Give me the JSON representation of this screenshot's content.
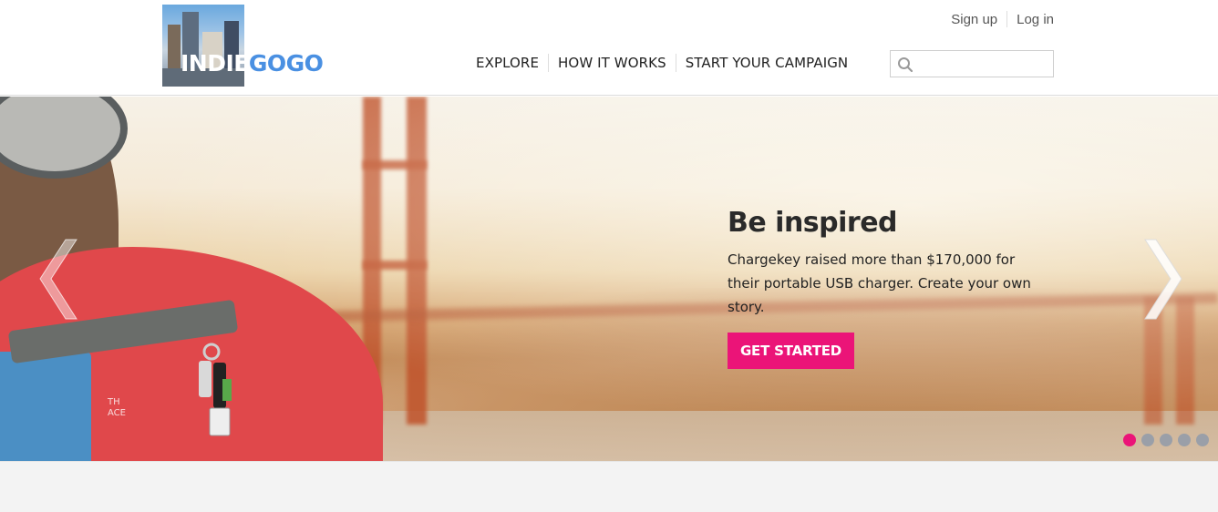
{
  "header": {
    "logo": {
      "part1": "INDIE",
      "part2": "GOGO"
    },
    "util_links": {
      "signup": "Sign up",
      "login": "Log in"
    },
    "nav": [
      "EXPLORE",
      "HOW IT WORKS",
      "START YOUR CAMPAIGN"
    ],
    "search": {
      "placeholder": "",
      "value": ""
    }
  },
  "hero": {
    "title": "Be inspired",
    "body": "Chargekey raised more than $170,000 for their portable USB charger. Create your own story.",
    "cta_label": "GET STARTED",
    "slides_total": 5,
    "active_slide": 1,
    "brand_print": "TH\nACE"
  },
  "colors": {
    "accent": "#eb1478",
    "logo_blue": "#4a90e2",
    "dot_inactive": "#9a9fa8"
  },
  "icons": [
    "search-icon",
    "chevron-left-icon",
    "chevron-right-icon"
  ]
}
